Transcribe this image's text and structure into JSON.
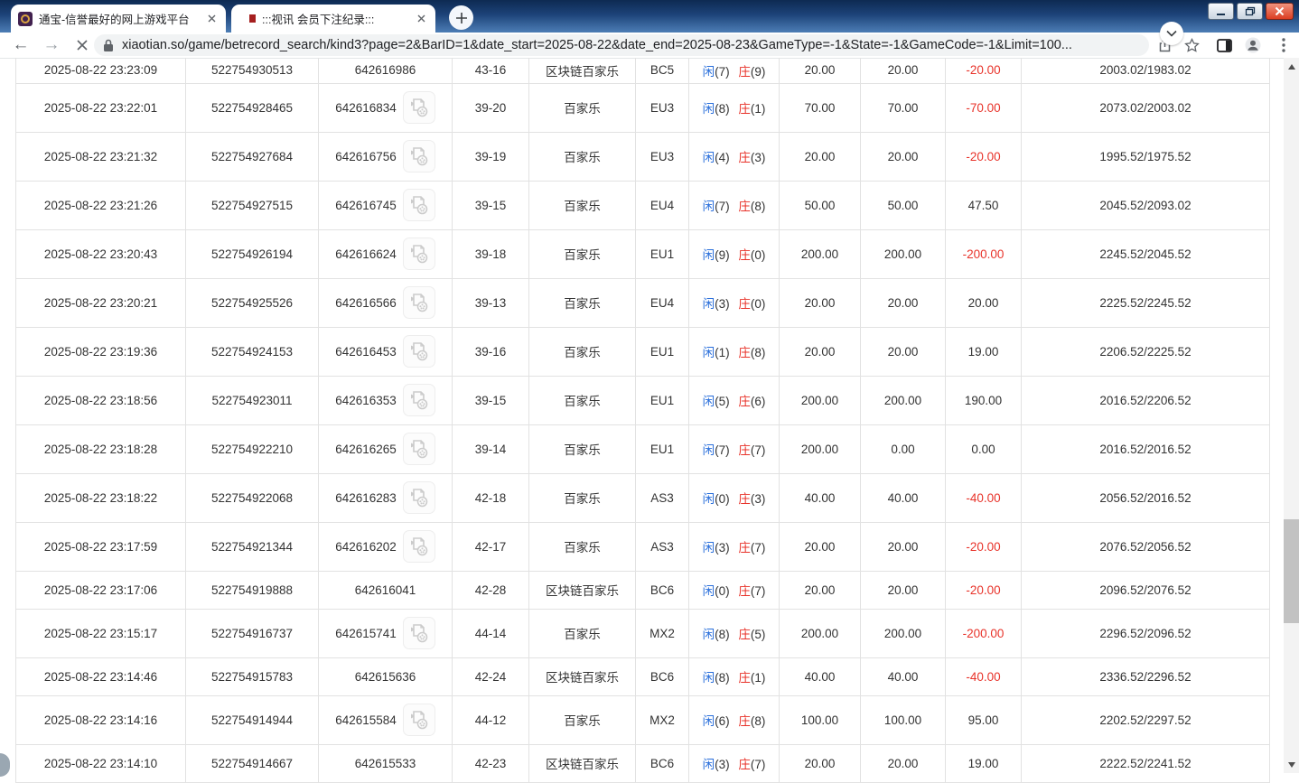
{
  "browser": {
    "tabs": [
      {
        "title": "通宝-信誉最好的网上游戏平台"
      },
      {
        "title": ":::视讯 会员下注纪录:::"
      }
    ],
    "url": "xiaotian.so/game/betrecord_search/kind3?page=2&BarID=1&date_start=2025-08-22&date_end=2025-08-23&GameType=-1&State=-1&GameCode=-1&Limit=100..."
  },
  "colors": {
    "accent_blue": "#2a6fdb",
    "loss_red": "#e8332a",
    "tabstrip_top": "#0d2a52",
    "tabstrip_bottom": "#4d7eb6"
  },
  "table": {
    "labels": {
      "player": "闲",
      "banker": "庄"
    },
    "rows": [
      {
        "time": "2025-08-22 23:23:09",
        "id": "522754930513",
        "round": "642616986",
        "video": false,
        "table": "43-16",
        "type": "区块链百家乐",
        "code": "BC5",
        "player": "7",
        "banker": "9",
        "bet": "20.00",
        "valid": "20.00",
        "result": "-20.00",
        "balance": "2003.02/1983.02"
      },
      {
        "time": "2025-08-22 23:22:01",
        "id": "522754928465",
        "round": "642616834",
        "video": true,
        "table": "39-20",
        "type": "百家乐",
        "code": "EU3",
        "player": "8",
        "banker": "1",
        "bet": "70.00",
        "valid": "70.00",
        "result": "-70.00",
        "balance": "2073.02/2003.02"
      },
      {
        "time": "2025-08-22 23:21:32",
        "id": "522754927684",
        "round": "642616756",
        "video": true,
        "table": "39-19",
        "type": "百家乐",
        "code": "EU3",
        "player": "4",
        "banker": "3",
        "bet": "20.00",
        "valid": "20.00",
        "result": "-20.00",
        "balance": "1995.52/1975.52"
      },
      {
        "time": "2025-08-22 23:21:26",
        "id": "522754927515",
        "round": "642616745",
        "video": true,
        "table": "39-15",
        "type": "百家乐",
        "code": "EU4",
        "player": "7",
        "banker": "8",
        "bet": "50.00",
        "valid": "50.00",
        "result": "47.50",
        "balance": "2045.52/2093.02"
      },
      {
        "time": "2025-08-22 23:20:43",
        "id": "522754926194",
        "round": "642616624",
        "video": true,
        "table": "39-18",
        "type": "百家乐",
        "code": "EU1",
        "player": "9",
        "banker": "0",
        "bet": "200.00",
        "valid": "200.00",
        "result": "-200.00",
        "balance": "2245.52/2045.52"
      },
      {
        "time": "2025-08-22 23:20:21",
        "id": "522754925526",
        "round": "642616566",
        "video": true,
        "table": "39-13",
        "type": "百家乐",
        "code": "EU4",
        "player": "3",
        "banker": "0",
        "bet": "20.00",
        "valid": "20.00",
        "result": "20.00",
        "balance": "2225.52/2245.52"
      },
      {
        "time": "2025-08-22 23:19:36",
        "id": "522754924153",
        "round": "642616453",
        "video": true,
        "table": "39-16",
        "type": "百家乐",
        "code": "EU1",
        "player": "1",
        "banker": "8",
        "bet": "20.00",
        "valid": "20.00",
        "result": "19.00",
        "balance": "2206.52/2225.52"
      },
      {
        "time": "2025-08-22 23:18:56",
        "id": "522754923011",
        "round": "642616353",
        "video": true,
        "table": "39-15",
        "type": "百家乐",
        "code": "EU1",
        "player": "5",
        "banker": "6",
        "bet": "200.00",
        "valid": "200.00",
        "result": "190.00",
        "balance": "2016.52/2206.52"
      },
      {
        "time": "2025-08-22 23:18:28",
        "id": "522754922210",
        "round": "642616265",
        "video": true,
        "table": "39-14",
        "type": "百家乐",
        "code": "EU1",
        "player": "7",
        "banker": "7",
        "bet": "200.00",
        "valid": "0.00",
        "result": "0.00",
        "balance": "2016.52/2016.52"
      },
      {
        "time": "2025-08-22 23:18:22",
        "id": "522754922068",
        "round": "642616283",
        "video": true,
        "table": "42-18",
        "type": "百家乐",
        "code": "AS3",
        "player": "0",
        "banker": "3",
        "bet": "40.00",
        "valid": "40.00",
        "result": "-40.00",
        "balance": "2056.52/2016.52"
      },
      {
        "time": "2025-08-22 23:17:59",
        "id": "522754921344",
        "round": "642616202",
        "video": true,
        "table": "42-17",
        "type": "百家乐",
        "code": "AS3",
        "player": "3",
        "banker": "7",
        "bet": "20.00",
        "valid": "20.00",
        "result": "-20.00",
        "balance": "2076.52/2056.52"
      },
      {
        "time": "2025-08-22 23:17:06",
        "id": "522754919888",
        "round": "642616041",
        "video": false,
        "table": "42-28",
        "type": "区块链百家乐",
        "code": "BC6",
        "player": "0",
        "banker": "7",
        "bet": "20.00",
        "valid": "20.00",
        "result": "-20.00",
        "balance": "2096.52/2076.52"
      },
      {
        "time": "2025-08-22 23:15:17",
        "id": "522754916737",
        "round": "642615741",
        "video": true,
        "table": "44-14",
        "type": "百家乐",
        "code": "MX2",
        "player": "8",
        "banker": "5",
        "bet": "200.00",
        "valid": "200.00",
        "result": "-200.00",
        "balance": "2296.52/2096.52"
      },
      {
        "time": "2025-08-22 23:14:46",
        "id": "522754915783",
        "round": "642615636",
        "video": false,
        "table": "42-24",
        "type": "区块链百家乐",
        "code": "BC6",
        "player": "8",
        "banker": "1",
        "bet": "40.00",
        "valid": "40.00",
        "result": "-40.00",
        "balance": "2336.52/2296.52"
      },
      {
        "time": "2025-08-22 23:14:16",
        "id": "522754914944",
        "round": "642615584",
        "video": true,
        "table": "44-12",
        "type": "百家乐",
        "code": "MX2",
        "player": "6",
        "banker": "8",
        "bet": "100.00",
        "valid": "100.00",
        "result": "95.00",
        "balance": "2202.52/2297.52"
      },
      {
        "time": "2025-08-22 23:14:10",
        "id": "522754914667",
        "round": "642615533",
        "video": false,
        "table": "42-23",
        "type": "区块链百家乐",
        "code": "BC6",
        "player": "3",
        "banker": "7",
        "bet": "20.00",
        "valid": "20.00",
        "result": "19.00",
        "balance": "2222.52/2241.52"
      }
    ]
  }
}
